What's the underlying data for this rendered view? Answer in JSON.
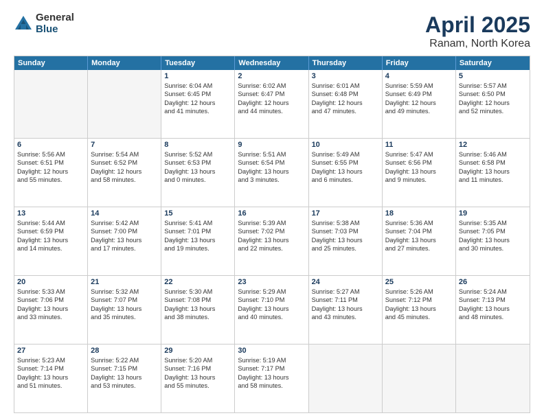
{
  "logo": {
    "general": "General",
    "blue": "Blue"
  },
  "title": {
    "month": "April 2025",
    "location": "Ranam, North Korea"
  },
  "header_days": [
    "Sunday",
    "Monday",
    "Tuesday",
    "Wednesday",
    "Thursday",
    "Friday",
    "Saturday"
  ],
  "rows": [
    [
      {
        "day": "",
        "lines": [],
        "empty": true
      },
      {
        "day": "",
        "lines": [],
        "empty": true
      },
      {
        "day": "1",
        "lines": [
          "Sunrise: 6:04 AM",
          "Sunset: 6:45 PM",
          "Daylight: 12 hours",
          "and 41 minutes."
        ]
      },
      {
        "day": "2",
        "lines": [
          "Sunrise: 6:02 AM",
          "Sunset: 6:47 PM",
          "Daylight: 12 hours",
          "and 44 minutes."
        ]
      },
      {
        "day": "3",
        "lines": [
          "Sunrise: 6:01 AM",
          "Sunset: 6:48 PM",
          "Daylight: 12 hours",
          "and 47 minutes."
        ]
      },
      {
        "day": "4",
        "lines": [
          "Sunrise: 5:59 AM",
          "Sunset: 6:49 PM",
          "Daylight: 12 hours",
          "and 49 minutes."
        ]
      },
      {
        "day": "5",
        "lines": [
          "Sunrise: 5:57 AM",
          "Sunset: 6:50 PM",
          "Daylight: 12 hours",
          "and 52 minutes."
        ]
      }
    ],
    [
      {
        "day": "6",
        "lines": [
          "Sunrise: 5:56 AM",
          "Sunset: 6:51 PM",
          "Daylight: 12 hours",
          "and 55 minutes."
        ]
      },
      {
        "day": "7",
        "lines": [
          "Sunrise: 5:54 AM",
          "Sunset: 6:52 PM",
          "Daylight: 12 hours",
          "and 58 minutes."
        ]
      },
      {
        "day": "8",
        "lines": [
          "Sunrise: 5:52 AM",
          "Sunset: 6:53 PM",
          "Daylight: 13 hours",
          "and 0 minutes."
        ]
      },
      {
        "day": "9",
        "lines": [
          "Sunrise: 5:51 AM",
          "Sunset: 6:54 PM",
          "Daylight: 13 hours",
          "and 3 minutes."
        ]
      },
      {
        "day": "10",
        "lines": [
          "Sunrise: 5:49 AM",
          "Sunset: 6:55 PM",
          "Daylight: 13 hours",
          "and 6 minutes."
        ]
      },
      {
        "day": "11",
        "lines": [
          "Sunrise: 5:47 AM",
          "Sunset: 6:56 PM",
          "Daylight: 13 hours",
          "and 9 minutes."
        ]
      },
      {
        "day": "12",
        "lines": [
          "Sunrise: 5:46 AM",
          "Sunset: 6:58 PM",
          "Daylight: 13 hours",
          "and 11 minutes."
        ]
      }
    ],
    [
      {
        "day": "13",
        "lines": [
          "Sunrise: 5:44 AM",
          "Sunset: 6:59 PM",
          "Daylight: 13 hours",
          "and 14 minutes."
        ]
      },
      {
        "day": "14",
        "lines": [
          "Sunrise: 5:42 AM",
          "Sunset: 7:00 PM",
          "Daylight: 13 hours",
          "and 17 minutes."
        ]
      },
      {
        "day": "15",
        "lines": [
          "Sunrise: 5:41 AM",
          "Sunset: 7:01 PM",
          "Daylight: 13 hours",
          "and 19 minutes."
        ]
      },
      {
        "day": "16",
        "lines": [
          "Sunrise: 5:39 AM",
          "Sunset: 7:02 PM",
          "Daylight: 13 hours",
          "and 22 minutes."
        ]
      },
      {
        "day": "17",
        "lines": [
          "Sunrise: 5:38 AM",
          "Sunset: 7:03 PM",
          "Daylight: 13 hours",
          "and 25 minutes."
        ]
      },
      {
        "day": "18",
        "lines": [
          "Sunrise: 5:36 AM",
          "Sunset: 7:04 PM",
          "Daylight: 13 hours",
          "and 27 minutes."
        ]
      },
      {
        "day": "19",
        "lines": [
          "Sunrise: 5:35 AM",
          "Sunset: 7:05 PM",
          "Daylight: 13 hours",
          "and 30 minutes."
        ]
      }
    ],
    [
      {
        "day": "20",
        "lines": [
          "Sunrise: 5:33 AM",
          "Sunset: 7:06 PM",
          "Daylight: 13 hours",
          "and 33 minutes."
        ]
      },
      {
        "day": "21",
        "lines": [
          "Sunrise: 5:32 AM",
          "Sunset: 7:07 PM",
          "Daylight: 13 hours",
          "and 35 minutes."
        ]
      },
      {
        "day": "22",
        "lines": [
          "Sunrise: 5:30 AM",
          "Sunset: 7:08 PM",
          "Daylight: 13 hours",
          "and 38 minutes."
        ]
      },
      {
        "day": "23",
        "lines": [
          "Sunrise: 5:29 AM",
          "Sunset: 7:10 PM",
          "Daylight: 13 hours",
          "and 40 minutes."
        ]
      },
      {
        "day": "24",
        "lines": [
          "Sunrise: 5:27 AM",
          "Sunset: 7:11 PM",
          "Daylight: 13 hours",
          "and 43 minutes."
        ]
      },
      {
        "day": "25",
        "lines": [
          "Sunrise: 5:26 AM",
          "Sunset: 7:12 PM",
          "Daylight: 13 hours",
          "and 45 minutes."
        ]
      },
      {
        "day": "26",
        "lines": [
          "Sunrise: 5:24 AM",
          "Sunset: 7:13 PM",
          "Daylight: 13 hours",
          "and 48 minutes."
        ]
      }
    ],
    [
      {
        "day": "27",
        "lines": [
          "Sunrise: 5:23 AM",
          "Sunset: 7:14 PM",
          "Daylight: 13 hours",
          "and 51 minutes."
        ]
      },
      {
        "day": "28",
        "lines": [
          "Sunrise: 5:22 AM",
          "Sunset: 7:15 PM",
          "Daylight: 13 hours",
          "and 53 minutes."
        ]
      },
      {
        "day": "29",
        "lines": [
          "Sunrise: 5:20 AM",
          "Sunset: 7:16 PM",
          "Daylight: 13 hours",
          "and 55 minutes."
        ]
      },
      {
        "day": "30",
        "lines": [
          "Sunrise: 5:19 AM",
          "Sunset: 7:17 PM",
          "Daylight: 13 hours",
          "and 58 minutes."
        ]
      },
      {
        "day": "",
        "lines": [],
        "empty": true
      },
      {
        "day": "",
        "lines": [],
        "empty": true
      },
      {
        "day": "",
        "lines": [],
        "empty": true
      }
    ]
  ]
}
